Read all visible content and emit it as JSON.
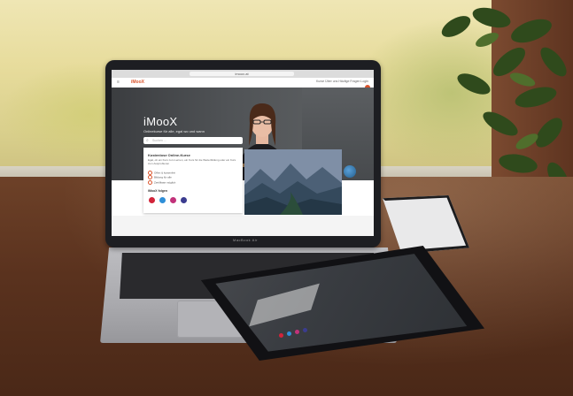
{
  "website": {
    "url": "imoox.at",
    "logo": "iMooX",
    "menu_icon": "hamburger-icon",
    "nav_links": "Kurse   Über uns   Häufige Fragen   Login",
    "hero": {
      "title": "iMooX",
      "subtitle": "Onlinekurse für alle, egal wo und wann",
      "search_placeholder": "Suchen ..."
    },
    "card": {
      "title": "Kostenlose Online-Kurse",
      "text": "Egal, ob ein Kurs zum Lernen, ein Kurs für die Weiterbildung oder ein Kurs zum Ausprobieren",
      "list": [
        "Offen & kostenfrei",
        "Bildung für alle",
        "Zertifikate möglich"
      ],
      "follow_label": "iMooX folgen"
    },
    "social_icons": [
      "youtube-icon",
      "twitter-icon",
      "instagram-icon",
      "linkedin-icon"
    ]
  },
  "laptop": {
    "brand_label": "MacBook Air"
  },
  "colors": {
    "brand": "#d9532b",
    "hero_bg": "#4a4d50",
    "table_wood": "#5a321e"
  }
}
